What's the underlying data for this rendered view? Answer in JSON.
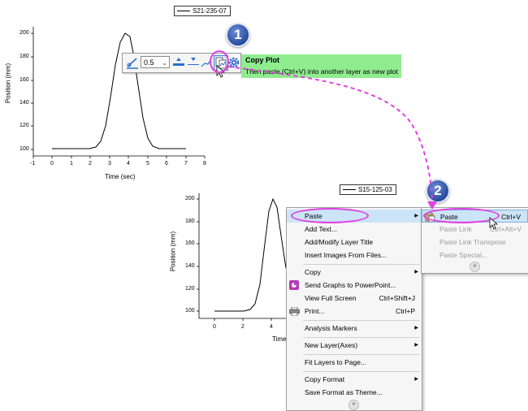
{
  "graph_top": {
    "legend": "S21-235-07",
    "ylabel": "Position (mm)",
    "xlabel": "Time (sec)",
    "yticks": [
      "200",
      "180",
      "160",
      "140",
      "120",
      "100"
    ],
    "xticks": [
      "-1",
      "0",
      "1",
      "2",
      "3",
      "4",
      "5",
      "6",
      "7",
      "8"
    ]
  },
  "graph_bottom": {
    "legend": "S15-125-03",
    "ylabel": "Position (mm)",
    "xlabel": "Time",
    "yticks": [
      "200",
      "180",
      "160",
      "140",
      "120",
      "100"
    ],
    "xticks": [
      "0",
      "2",
      "4"
    ]
  },
  "mini_toolbar": {
    "line_width": "0.5"
  },
  "tooltip": {
    "title": "Copy Plot",
    "description": "Then paste (Ctrl+V) into another layer as new plot"
  },
  "steps": [
    "1",
    "2"
  ],
  "context_menu": {
    "items": [
      {
        "label": "Paste",
        "shortcut": ""
      },
      {
        "label": "Add Text...",
        "shortcut": ""
      },
      {
        "label": "Add/Modify Layer Title",
        "shortcut": ""
      },
      {
        "label": "Insert Images From Files...",
        "shortcut": ""
      },
      {
        "label": "Copy",
        "shortcut": ""
      },
      {
        "label": "Send Graphs to PowerPoint...",
        "shortcut": ""
      },
      {
        "label": "View Full Screen",
        "shortcut": "Ctrl+Shift+J"
      },
      {
        "label": "Print...",
        "shortcut": "Ctrl+P"
      },
      {
        "label": "Analysis Markers",
        "shortcut": ""
      },
      {
        "label": "New Layer(Axes)",
        "shortcut": ""
      },
      {
        "label": "Fit Layers to Page...",
        "shortcut": ""
      },
      {
        "label": "Copy Format",
        "shortcut": ""
      },
      {
        "label": "Save Format as Theme...",
        "shortcut": ""
      }
    ]
  },
  "submenu": {
    "items": [
      {
        "label": "Paste",
        "shortcut": "Ctrl+V"
      },
      {
        "label": "Paste Link",
        "shortcut": "Ctrl+Alt+V"
      },
      {
        "label": "Paste Link Transpose",
        "shortcut": ""
      },
      {
        "label": "Paste Special...",
        "shortcut": ""
      }
    ]
  },
  "colors": {
    "highlight": "#e040e0",
    "tooltip_bg": "#8fec8f",
    "badge": "#2a4a9e",
    "menu_hover": "#cce4f7"
  }
}
